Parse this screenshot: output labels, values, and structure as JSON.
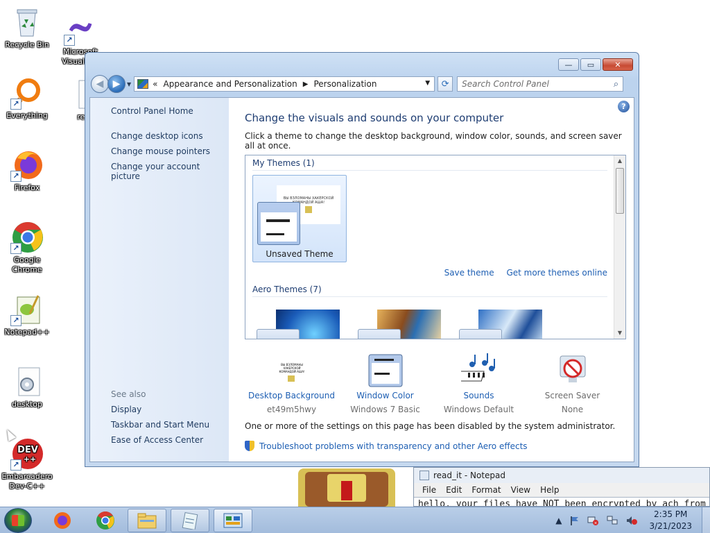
{
  "desktop": {
    "icons": [
      {
        "label": "Recycle Bin"
      },
      {
        "label": "Microsoft Visual S..."
      },
      {
        "label": "Everything"
      },
      {
        "label": "read..."
      },
      {
        "label": "Firefox"
      },
      {
        "label": "Google Chrome"
      },
      {
        "label": "Notepad++"
      },
      {
        "label": "desktop"
      },
      {
        "label": "Embarcadero Dev-C++"
      }
    ]
  },
  "window": {
    "address": {
      "breadcrumb_prefix": "«",
      "crumbs": [
        "Appearance and Personalization",
        "Personalization"
      ],
      "separator": "▶",
      "dropdown": "▼",
      "refresh": "⟳"
    },
    "search": {
      "placeholder": "Search Control Panel",
      "icon": "⌕"
    },
    "controls": {
      "minimize": "—",
      "maximize": "▭",
      "close": "✕"
    },
    "sidebar": {
      "home": "Control Panel Home",
      "links": [
        "Change desktop icons",
        "Change mouse pointers",
        "Change your account picture"
      ],
      "see_also_label": "See also",
      "see_also": [
        "Display",
        "Taskbar and Start Menu",
        "Ease of Access Center"
      ]
    },
    "main": {
      "heading": "Change the visuals and sounds on your computer",
      "subtitle": "Click a theme to change the desktop background, window color, sounds, and screen saver all at once.",
      "help": "?",
      "my_themes_label": "My Themes (1)",
      "unsaved_theme": "Unsaved Theme",
      "preview_text": "ВЫ ВЗЛОМАНЫ ХАКЕРСКОЙ КОМАНДОЙ АША!",
      "save_theme": "Save theme",
      "get_more_themes": "Get more themes online",
      "aero_themes_label": "Aero Themes (7)",
      "settings": [
        {
          "label": "Desktop Background",
          "value": "et49m5hwy"
        },
        {
          "label": "Window Color",
          "value": "Windows 7 Basic"
        },
        {
          "label": "Sounds",
          "value": "Windows Default"
        },
        {
          "label": "Screen Saver",
          "value": "None"
        }
      ],
      "admin_note": "One or more of the settings on this page has been disabled by the system administrator.",
      "troubleshoot": "Troubleshoot problems with transparency and other Aero effects"
    }
  },
  "notepad": {
    "title": "read_it - Notepad",
    "menu": [
      "File",
      "Edit",
      "Format",
      "View",
      "Help"
    ],
    "text": "hello, your files have NOT been encrypted by ach from"
  },
  "taskbar": {
    "clock_time": "2:35 PM",
    "clock_date": "3/21/2023",
    "tray_chevron": "▲"
  },
  "colors": {
    "link": "#1e5fb3",
    "heading": "#1e3d72",
    "taskbar": "#b9cee8"
  }
}
